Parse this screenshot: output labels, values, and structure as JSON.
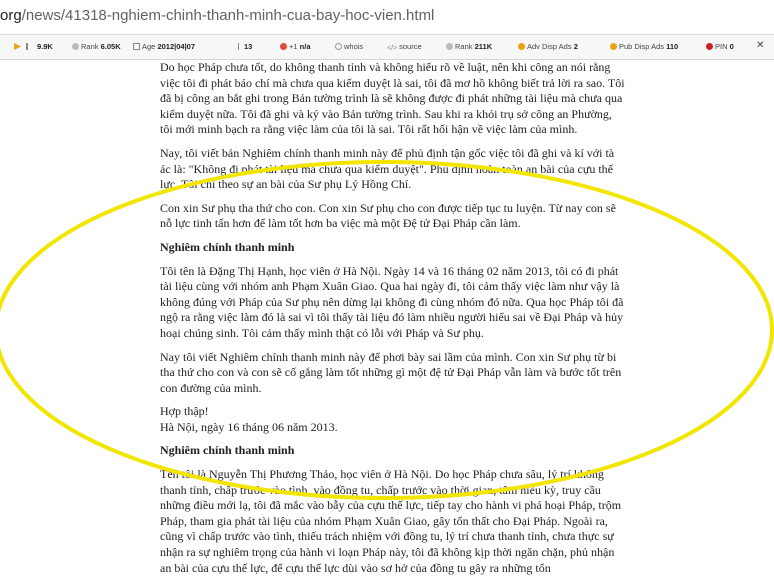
{
  "address_bar": {
    "domain": "org",
    "path": "/news/41318-nghiem-chinh-thanh-minh-cua-bay-hoc-vien.html"
  },
  "toolbar": {
    "items": [
      {
        "icon": "arrow-icon",
        "label": "",
        "value": ""
      },
      {
        "icon": "bar-chart-icon",
        "label": "",
        "value": "9.9K"
      },
      {
        "icon": "rank-icon",
        "label": "Rank",
        "value": "6.05K"
      },
      {
        "icon": "calendar-icon",
        "label": "Age",
        "value": "2012|04|07"
      },
      {
        "icon": "index-icon",
        "label": "",
        "value": "13"
      },
      {
        "icon": "google-plus-icon",
        "label": "+1",
        "value": "n/a"
      },
      {
        "icon": "whois-icon",
        "label": "whois",
        "value": ""
      },
      {
        "icon": "source-icon",
        "label": "source",
        "value": ""
      },
      {
        "icon": "rank-icon",
        "label": "Rank",
        "value": "211K"
      },
      {
        "icon": "adv-disp-icon",
        "label": "Adv Disp Ads",
        "value": "2"
      },
      {
        "icon": "pub-disp-icon",
        "label": "Pub Disp Ads",
        "value": "110"
      },
      {
        "icon": "pinterest-icon",
        "label": "PIN",
        "value": "0"
      }
    ]
  },
  "article": {
    "p1": "Do học Pháp chưa tốt, do không thanh tỉnh và không hiểu rõ về luật, nên khi công an nói rằng việc tôi đi phát báo chí mà chưa qua kiểm duyệt là sai, tôi đã mơ hồ không biết trả lời ra sao. Tôi đã bị công an bắt ghi trong Bản tường trình là sẽ không được đi phát những tài liệu mà chưa qua kiểm duyệt nữa. Tôi đã ghi và ký vào Bản tường trình. Sau khi ra khỏi trụ sở công an Phường, tôi mới minh bạch ra rằng việc làm của tôi là sai. Tôi rất hối hận về việc làm của mình.",
    "p2": "Nay, tôi viết bản Nghiêm chính thanh minh này để phủ định tận gốc việc tôi đã ghi và kí với tà ác là: \"Không đi phát tài liệu mà chưa qua kiểm duyệt\". Phủ định hoàn toàn an bài của cựu thế lực. Tôi chỉ theo sự an bài của Sư phụ Lý Hồng Chí.",
    "p3": "Con xin Sư phụ tha thứ cho con. Con xin Sư phụ cho con được tiếp tục tu luyện. Từ nay con sẽ nỗ lực tinh tấn hơn để làm tốt hơn ba việc mà một Đệ tử Đại Pháp cần làm.",
    "h1": "Nghiêm chính thanh minh",
    "p4": "Tôi tên là Đặng Thị Hạnh, học viên ở Hà Nội. Ngày 14 và 16 tháng 02 năm 2013, tôi có đi phát tài liệu cùng với nhóm anh Phạm Xuân Giao. Qua hai ngày đi, tôi cảm thấy việc làm như vậy là không đúng với Pháp của Sư phụ nên dừng lại không đi cùng nhóm đó nữa. Qua học Pháp tôi đã ngộ ra rằng việc làm đó là sai vì tôi thấy tài liệu đó làm nhiều người hiểu sai về Đại Pháp và hủy hoại chúng sinh. Tôi cảm thấy mình thật có lỗi với Pháp và Sư phụ.",
    "p5": "Nay tôi viết Nghiêm chính thanh minh này để phơi bày sai lầm của mình. Con xin Sư phụ từ bi tha thứ cho con và con sẽ cố gắng làm tốt những gì một đệ tử Đại Pháp vẫn làm và bước tốt trên con đường của mình.",
    "sign1": "Hợp thập!",
    "sign2": "Hà Nội, ngày 16 tháng 06 năm 2013.",
    "h2": "Nghiêm chính thanh minh",
    "p6": "Tên tôi là Nguyễn Thị Phương Thảo, học viên ở Hà Nội. Do học Pháp chưa sâu, lý trí không thanh tỉnh, chấp trước vào tình, vào đồng tu, chấp trước vào thời gian, tâm hiếu kỳ, truy cầu những điều mới lạ, tôi đã mắc vào bẫy của cựu thế lực, tiếp tay cho hành vi phá hoại Pháp, trộm Pháp, tham gia phát tài liệu của nhóm Phạm Xuân Giao, gây tổn thất cho Đại Pháp. Ngoài ra, cũng vì chấp trước vào tình, thiếu trách nhiệm với đồng tu, lý trí chưa thanh tỉnh, chưa thực sự nhận ra sự nghiêm trọng của hành vi loạn Pháp này, tôi đã không kịp thời ngăn chặn, phủ nhận an bài của cựu thế lực, để cựu thế lực dùi vào sơ hở của đồng tu gây ra những tổn"
  },
  "colors": {
    "annotation_ellipse": "#f2e600",
    "text": "#222222"
  }
}
